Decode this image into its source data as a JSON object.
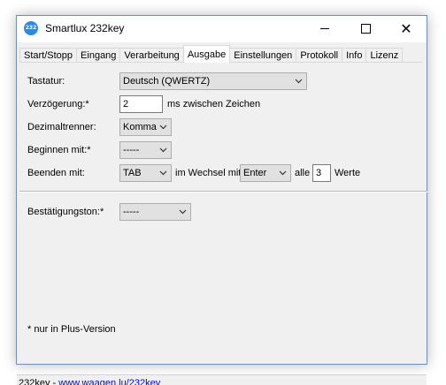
{
  "window": {
    "title": "Smartlux 232key",
    "icon_text": "232 key",
    "icon": "app-icon"
  },
  "tabs": [
    {
      "label": "Start/Stopp",
      "active": false
    },
    {
      "label": "Eingang",
      "active": false
    },
    {
      "label": "Verarbeitung",
      "active": false
    },
    {
      "label": "Ausgabe",
      "active": true
    },
    {
      "label": "Einstellungen",
      "active": false
    },
    {
      "label": "Protokoll",
      "active": false
    },
    {
      "label": "Info",
      "active": false
    },
    {
      "label": "Lizenz",
      "active": false
    }
  ],
  "form": {
    "tastatur": {
      "label": "Tastatur:",
      "value": "Deutsch (QWERTZ)"
    },
    "verzoegerung": {
      "label": "Verzögerung:*",
      "value": "2",
      "suffix": "ms zwischen Zeichen"
    },
    "dezimal": {
      "label": "Dezimaltrenner:",
      "value": "Komma"
    },
    "beginnen": {
      "label": "Beginnen mit:*",
      "value": "-----"
    },
    "beenden": {
      "label": "Beenden mit:",
      "value": "TAB",
      "wechsel_label": "im Wechsel mit",
      "wechsel_value": "Enter",
      "alle_label": "alle",
      "alle_value": "3",
      "werte_label": "Werte"
    },
    "bestaetigung": {
      "label": "Bestätigungston:*",
      "value": "-----"
    },
    "note": "* nur in Plus-Version"
  },
  "status": {
    "prefix": "232key - ",
    "link": "www.waagen.lu/232key"
  }
}
